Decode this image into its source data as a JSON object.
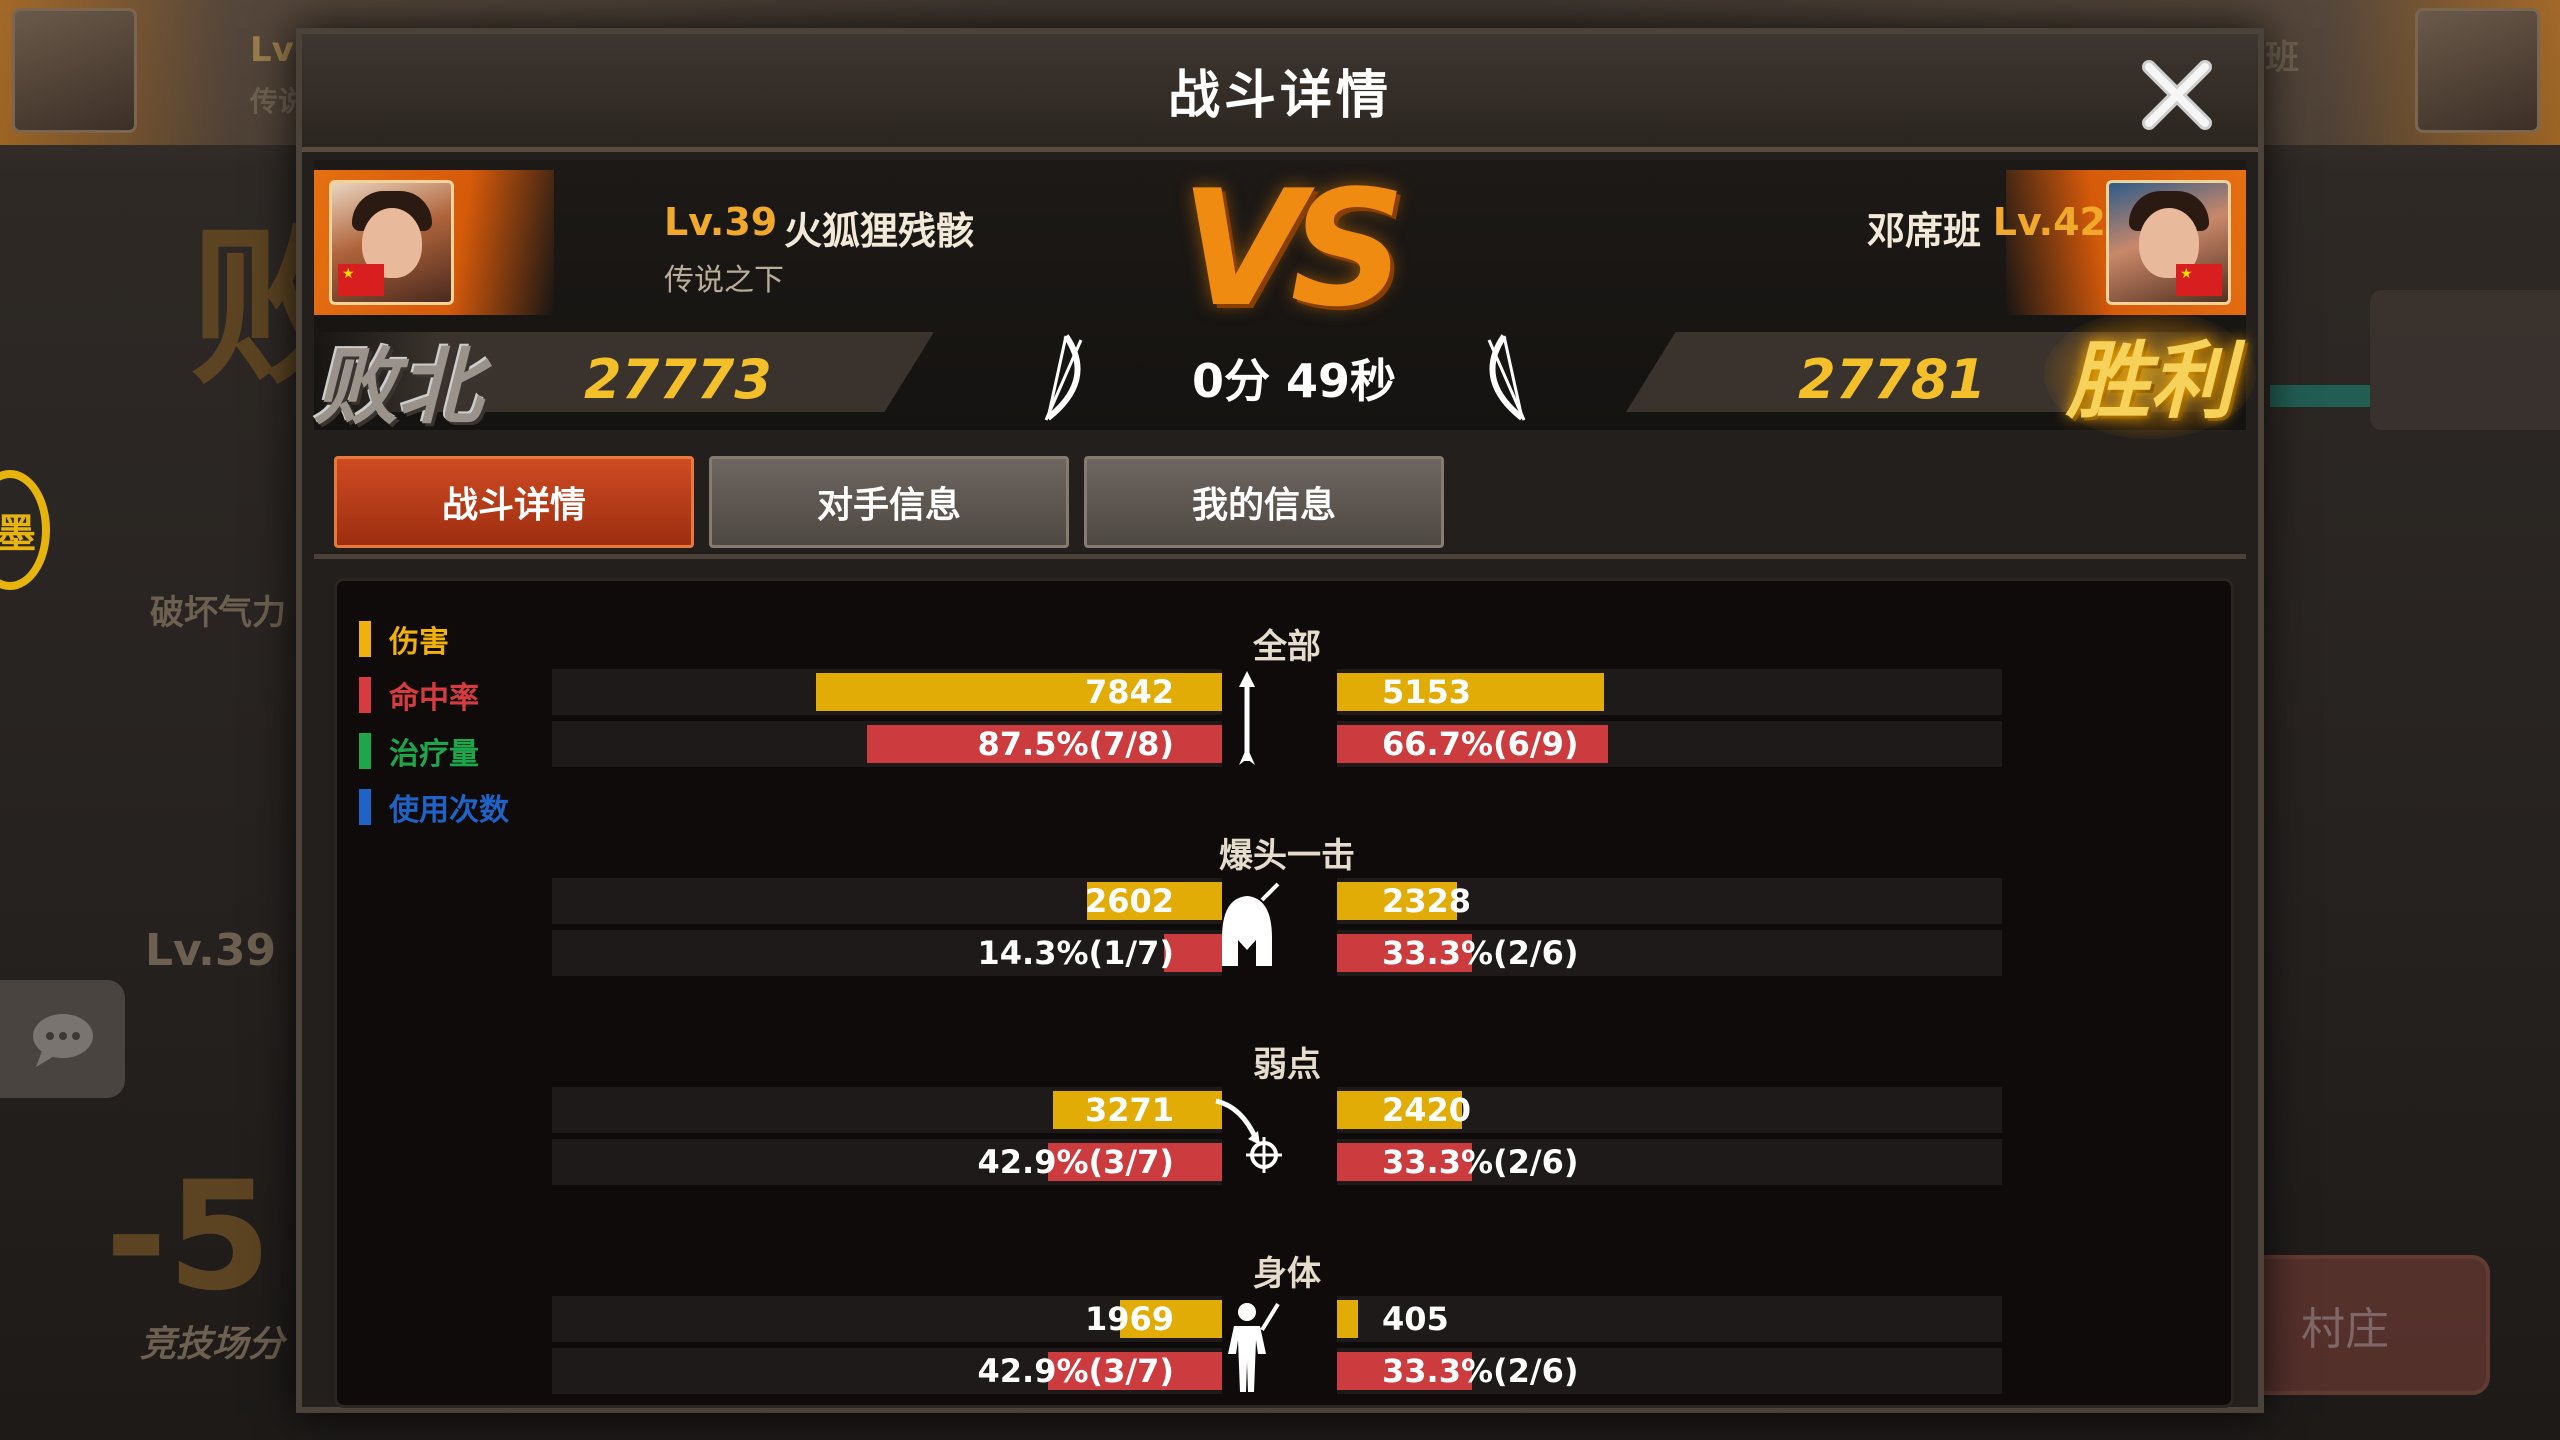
{
  "background": {
    "left_level": "Lv",
    "left_sub": "传说",
    "right_name": "班",
    "destroy_label": "破坏气力",
    "level_label": "Lv.39",
    "score_delta": "-5",
    "arena_label": "竞技场分",
    "village_label": "村庄",
    "seal_text": "墨",
    "big_char": "败"
  },
  "modal": {
    "title": "战斗详情",
    "close_label": "✕"
  },
  "left_player": {
    "level": "Lv.39",
    "name": "火狐狸残骸",
    "subtitle": "传说之下",
    "power": "27773",
    "result": "败北"
  },
  "right_player": {
    "level": "Lv.42",
    "name": "邓席班",
    "power": "27781",
    "result": "胜利"
  },
  "match": {
    "vs_text": "VS",
    "time": "0分 49秒"
  },
  "tabs": [
    "战斗详情",
    "对手信息",
    "我的信息"
  ],
  "legend": [
    {
      "label": "伤害",
      "color": "#f0b10a"
    },
    {
      "label": "命中率",
      "color": "#d63c3f"
    },
    {
      "label": "治疗量",
      "color": "#1ea64a"
    },
    {
      "label": "使用次数",
      "color": "#1f62c8"
    }
  ],
  "sections": [
    {
      "title": "全部",
      "icon": "arrow-icon",
      "damage": {
        "left": "7842",
        "right": "5153",
        "left_value": 7842,
        "right_value": 5153
      },
      "hit_rate": {
        "left": "87.5%(7/8)",
        "right": "66.7%(6/9)",
        "left_value": 87.5,
        "right_value": 66.7
      }
    },
    {
      "title": "爆头一击",
      "icon": "helmet-icon",
      "damage": {
        "left": "2602",
        "right": "2328",
        "left_value": 2602,
        "right_value": 2328
      },
      "hit_rate": {
        "left": "14.3%(1/7)",
        "right": "33.3%(2/6)",
        "left_value": 14.3,
        "right_value": 33.3
      }
    },
    {
      "title": "弱点",
      "icon": "target-arrow-icon",
      "damage": {
        "left": "3271",
        "right": "2420",
        "left_value": 3271,
        "right_value": 2420
      },
      "hit_rate": {
        "left": "42.9%(3/7)",
        "right": "33.3%(2/6)",
        "left_value": 42.9,
        "right_value": 33.3
      }
    },
    {
      "title": "身体",
      "icon": "body-icon",
      "damage": {
        "left": "1969",
        "right": "405",
        "left_value": 1969,
        "right_value": 405
      },
      "hit_rate": {
        "left": "42.9%(3/7)",
        "right": "33.3%(2/6)",
        "left_value": 42.9,
        "right_value": 33.3
      }
    }
  ]
}
